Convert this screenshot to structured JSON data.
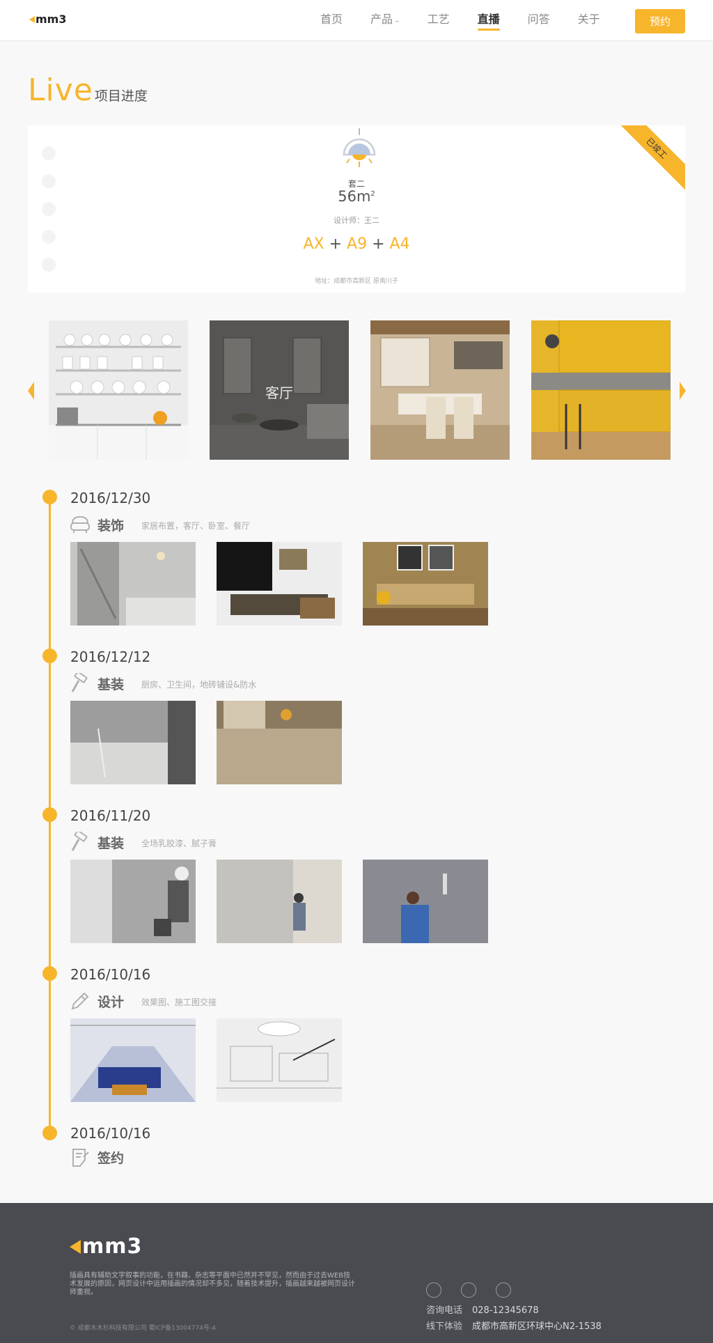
{
  "header": {
    "logo_text": "mm3",
    "nav": [
      {
        "label": "首页"
      },
      {
        "label": "产品"
      },
      {
        "label": "工艺"
      },
      {
        "label": "直播",
        "active": true
      },
      {
        "label": "问答"
      },
      {
        "label": "关于"
      }
    ],
    "book_button": "预约"
  },
  "page_title": {
    "live": "Live",
    "sub": "项目进度"
  },
  "project": {
    "type": "套二",
    "area": "56m",
    "area_unit_sup": "2",
    "designer": "设计师：王二",
    "combo": {
      "a": "AX",
      "plus1": "+",
      "b": "A9",
      "plus2": "+",
      "c": "A4"
    },
    "address": "地址：成都市高新区 原南川子",
    "status_ribbon": "已竣工"
  },
  "carousel": {
    "slides": [
      {
        "label": "",
        "color": "#d9d9d9"
      },
      {
        "label": "客厅",
        "color": "#5f5e5c"
      },
      {
        "label": "",
        "color": "#b29a78"
      },
      {
        "label": "",
        "color": "#e6b52a"
      }
    ]
  },
  "timeline": [
    {
      "date": "2016/12/30",
      "category": "装饰",
      "icon": "sofa-icon",
      "desc": "家居布置，客厅、卧室、餐厅",
      "photo_colors": [
        "#bcbcba",
        "#3e3a36",
        "#a08552"
      ]
    },
    {
      "date": "2016/12/12",
      "category": "基装",
      "icon": "hammer-icon",
      "desc": "厨房、卫生间，地砖铺设&防水",
      "photo_colors": [
        "#9c9d9c",
        "#8c7a60"
      ]
    },
    {
      "date": "2016/11/20",
      "category": "基装",
      "icon": "hammer-icon",
      "desc": "全场乳胶漆、腻子膏",
      "photo_colors": [
        "#a7a7a7",
        "#c4c2bd",
        "#6e7078"
      ]
    },
    {
      "date": "2016/10/16",
      "category": "设计",
      "icon": "pencil-icon",
      "desc": "效果图、施工图交接",
      "photo_colors": [
        "#7f8ab0",
        "#e0e0e0"
      ]
    },
    {
      "date": "2016/10/16",
      "category": "签约",
      "icon": "contract-icon",
      "desc": "",
      "photo_colors": []
    }
  ],
  "footer": {
    "logo_text": "mm3",
    "description": "插画具有辅助文字叙事的功能，在书籍、杂志等平面中已然并不罕见，然而由于过去WEB技术发展的原因，网页设计中运用插画的情况却不多见，随着技术提升，插画越来越被网页设计师重视。",
    "copyright": "© 成都木木杉科技有限公司 蜀ICP备13004774号-4",
    "social": [
      "wechat-icon",
      "qq-icon",
      "weibo-icon"
    ],
    "phone_label": "咨询电话",
    "phone": "028-12345678",
    "offline_label": "线下体验",
    "offline_address": "成都市高新区环球中心N2-1538"
  },
  "colors": {
    "accent": "#f7b52c",
    "footer_bg": "#4a4b50"
  }
}
